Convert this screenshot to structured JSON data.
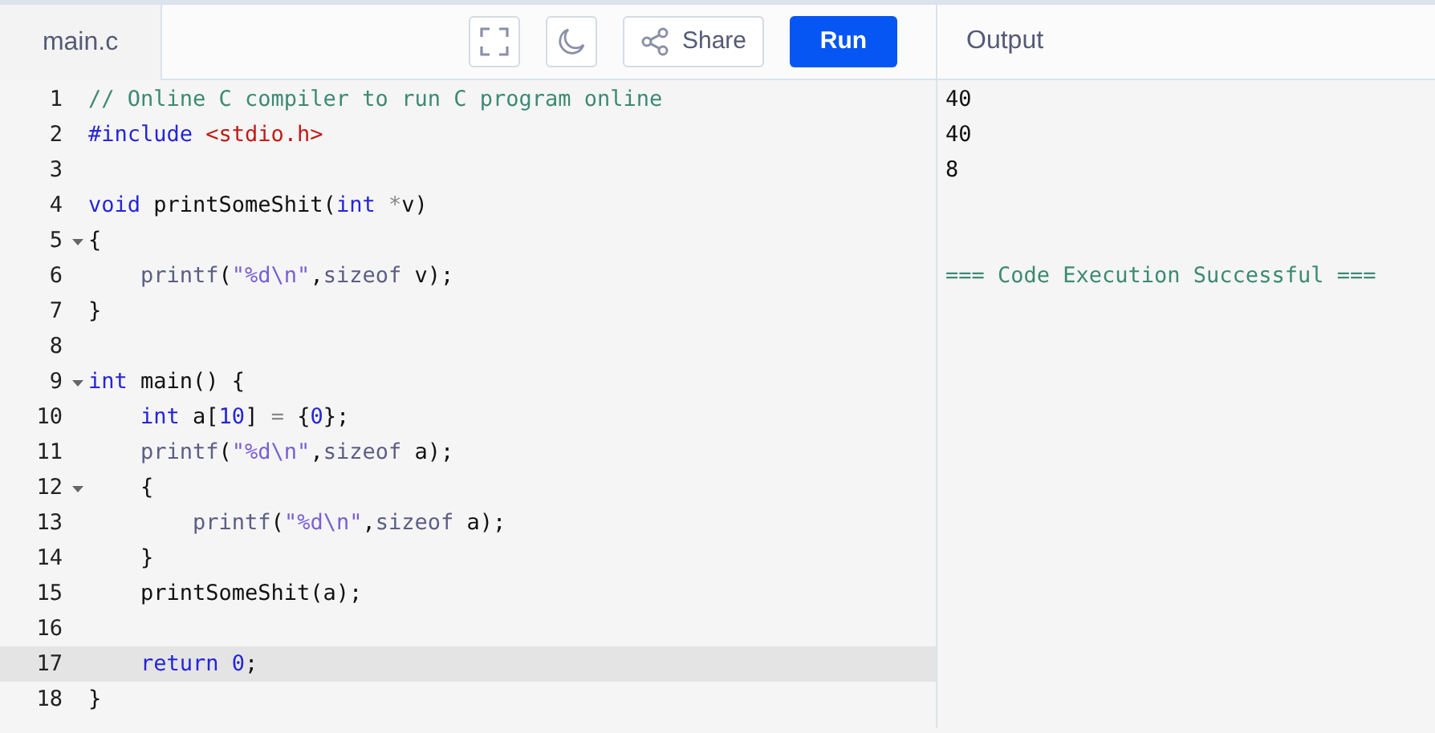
{
  "file_tab": {
    "label": "main.c",
    "selected": true
  },
  "toolbar": {
    "share_label": "Share",
    "run_label": "Run"
  },
  "output_tab": {
    "label": "Output"
  },
  "code_lines": [
    {
      "number": "1",
      "tokens": [
        {
          "text": "// Online C compiler to run C program online",
          "kind": "comment"
        }
      ]
    },
    {
      "number": "2",
      "tokens": [
        {
          "text": "#include ",
          "kind": "keyword"
        },
        {
          "text": "<stdio.h>",
          "kind": "path"
        }
      ]
    },
    {
      "number": "3"
    },
    {
      "number": "4",
      "tokens": [
        {
          "text": "void",
          "kind": "keyword"
        },
        {
          "text": " printSomeShit(",
          "kind": "plain"
        },
        {
          "text": "int",
          "kind": "keyword"
        },
        {
          "text": " *",
          "kind": "operator"
        },
        {
          "text": "v)",
          "kind": "plain"
        }
      ]
    },
    {
      "number": "5",
      "foldable": true,
      "tokens": [
        {
          "text": "{",
          "kind": "plain"
        }
      ]
    },
    {
      "number": "6",
      "tokens": [
        {
          "text": "    printf",
          "kind": "builtin"
        },
        {
          "text": "(",
          "kind": "plain"
        },
        {
          "text": "\"%d\\n\"",
          "kind": "string"
        },
        {
          "text": ",",
          "kind": "plain"
        },
        {
          "text": "sizeof",
          "kind": "builtin"
        },
        {
          "text": " v);",
          "kind": "plain"
        }
      ]
    },
    {
      "number": "7",
      "tokens": [
        {
          "text": "}",
          "kind": "plain"
        }
      ]
    },
    {
      "number": "8"
    },
    {
      "number": "9",
      "foldable": true,
      "tokens": [
        {
          "text": "int",
          "kind": "keyword"
        },
        {
          "text": " main() {",
          "kind": "plain"
        }
      ]
    },
    {
      "number": "10",
      "tokens": [
        {
          "text": "    int",
          "kind": "keyword"
        },
        {
          "text": " a[",
          "kind": "plain"
        },
        {
          "text": "10",
          "kind": "number"
        },
        {
          "text": "] ",
          "kind": "plain"
        },
        {
          "text": "=",
          "kind": "operator"
        },
        {
          "text": " {",
          "kind": "plain"
        },
        {
          "text": "0",
          "kind": "number"
        },
        {
          "text": "};",
          "kind": "plain"
        }
      ]
    },
    {
      "number": "11",
      "tokens": [
        {
          "text": "    printf",
          "kind": "builtin"
        },
        {
          "text": "(",
          "kind": "plain"
        },
        {
          "text": "\"%d\\n\"",
          "kind": "string"
        },
        {
          "text": ",",
          "kind": "plain"
        },
        {
          "text": "sizeof",
          "kind": "builtin"
        },
        {
          "text": " a);",
          "kind": "plain"
        }
      ]
    },
    {
      "number": "12",
      "foldable": true,
      "tokens": [
        {
          "text": "    {",
          "kind": "plain"
        }
      ]
    },
    {
      "number": "13",
      "tokens": [
        {
          "text": "        printf",
          "kind": "builtin"
        },
        {
          "text": "(",
          "kind": "plain"
        },
        {
          "text": "\"%d\\n\"",
          "kind": "string"
        },
        {
          "text": ",",
          "kind": "plain"
        },
        {
          "text": "sizeof",
          "kind": "builtin"
        },
        {
          "text": " a);",
          "kind": "plain"
        }
      ]
    },
    {
      "number": "14",
      "tokens": [
        {
          "text": "    }",
          "kind": "plain"
        }
      ]
    },
    {
      "number": "15",
      "tokens": [
        {
          "text": "    printSomeShit(a);",
          "kind": "plain"
        }
      ]
    },
    {
      "number": "16"
    },
    {
      "number": "17",
      "active": true,
      "tokens": [
        {
          "text": "    return 0",
          "kind": "keyword"
        },
        {
          "text": ";",
          "kind": "plain"
        }
      ]
    },
    {
      "number": "18",
      "tokens": [
        {
          "text": "}",
          "kind": "plain"
        }
      ]
    }
  ],
  "output_lines": [
    {
      "text": "40",
      "kind": "normal"
    },
    {
      "text": "40",
      "kind": "normal"
    },
    {
      "text": "8",
      "kind": "normal"
    },
    {
      "kind": "blank"
    },
    {
      "kind": "blank"
    },
    {
      "text": "=== Code Execution Successful ===",
      "kind": "success"
    }
  ]
}
